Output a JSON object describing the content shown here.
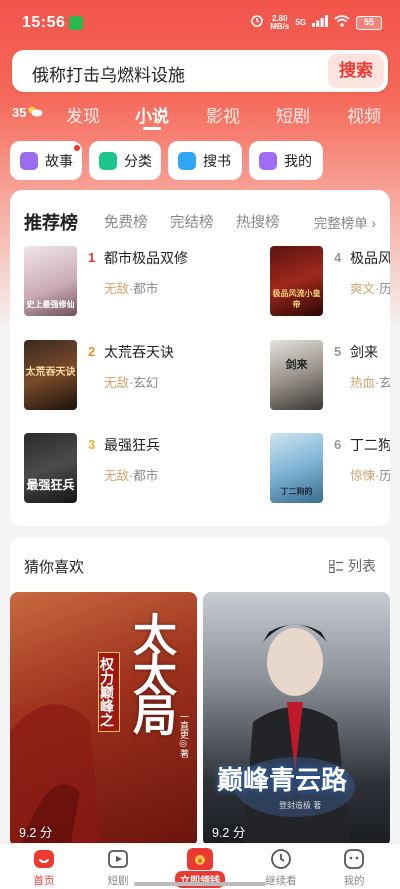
{
  "status": {
    "time": "15:56",
    "net_speed_value": "2.80",
    "net_speed_unit": "MB/s",
    "signal": "5G",
    "battery": "55"
  },
  "search": {
    "text": "俄称打击乌燃料设施",
    "button": "搜索"
  },
  "weather": {
    "temp": "35"
  },
  "tabs": [
    "发现",
    "小说",
    "影视",
    "短剧",
    "视频"
  ],
  "quick": [
    {
      "label": "故事"
    },
    {
      "label": "分类"
    },
    {
      "label": "搜书"
    },
    {
      "label": "我的"
    }
  ],
  "ranking": {
    "tabs": [
      "推荐榜",
      "免费榜",
      "完结榜",
      "热搜榜"
    ],
    "more": "完整榜单",
    "books": [
      {
        "rank": "1",
        "title": "都市极品双修",
        "tag1": "无敌",
        "tag2": "都市",
        "cover_text": "史上最强修仙",
        "rank_color": "#ec3a32"
      },
      {
        "rank": "2",
        "title": "太荒吞天诀",
        "tag1": "无敌",
        "tag2": "玄幻",
        "cover_text": "太荒吞天诀",
        "rank_color": "#f0902b"
      },
      {
        "rank": "3",
        "title": "最强狂兵",
        "tag1": "无敌",
        "tag2": "都市",
        "cover_text": "最强狂兵",
        "rank_color": "#f0b22b"
      },
      {
        "rank": "4",
        "title": "极品风",
        "tag1": "爽文",
        "tag2": "历",
        "cover_text": "极品风流小皇帝",
        "rank_color": "#999999"
      },
      {
        "rank": "5",
        "title": "剑来",
        "tag1": "热血",
        "tag2": "玄",
        "cover_text": "剑来",
        "rank_color": "#999999"
      },
      {
        "rank": "6",
        "title": "丁二狗",
        "tag1": "惊悚",
        "tag2": "历",
        "cover_text": "丁二狗的",
        "rank_color": "#999999"
      }
    ]
  },
  "guess": {
    "title": "猜你喜欢",
    "toggle": "列表",
    "posters": [
      {
        "score": "9.2 分",
        "main": "太太局",
        "sub": "权力巅峰之",
        "author": "一直更◎著"
      },
      {
        "score": "9.2 分",
        "main": "巅峰青云路",
        "author": "登封造极 著"
      }
    ]
  },
  "nav": {
    "items": [
      "首页",
      "短剧",
      "立即领钱",
      "继续看",
      "我的"
    ]
  },
  "colors": {
    "accent": "#ec3a32",
    "tag": "#d5a26e"
  }
}
